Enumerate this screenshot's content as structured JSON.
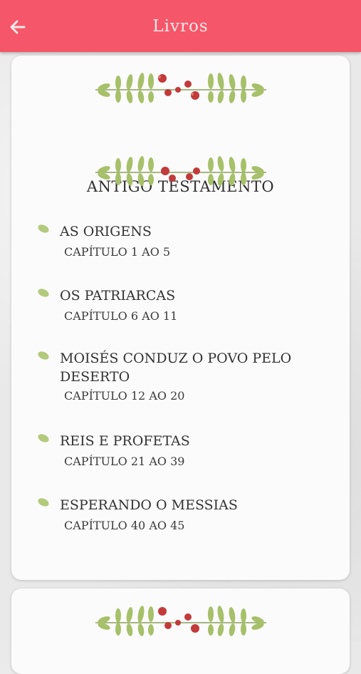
{
  "appbar": {
    "title": "Livros",
    "back_icon": "arrow-left-icon",
    "color": "#f5566a"
  },
  "section": {
    "heading": "ANTIGO TESTAMENTO",
    "items": [
      {
        "title": "AS ORIGENS",
        "subtitle": "CAPÍTULO 1 AO 5"
      },
      {
        "title": "OS PATRIARCAS",
        "subtitle": "CAPÍTULO 6 AO 11"
      },
      {
        "title": "MOISÉS CONDUZ O POVO PELO DESERTO",
        "subtitle": "CAPÍTULO 12 AO 20"
      },
      {
        "title": "REIS E PROFETAS",
        "subtitle": "CAPÍTULO 21 AO 39"
      },
      {
        "title": "ESPERANDO O MESSIAS",
        "subtitle": "CAPÍTULO 40 AO 45"
      }
    ]
  }
}
